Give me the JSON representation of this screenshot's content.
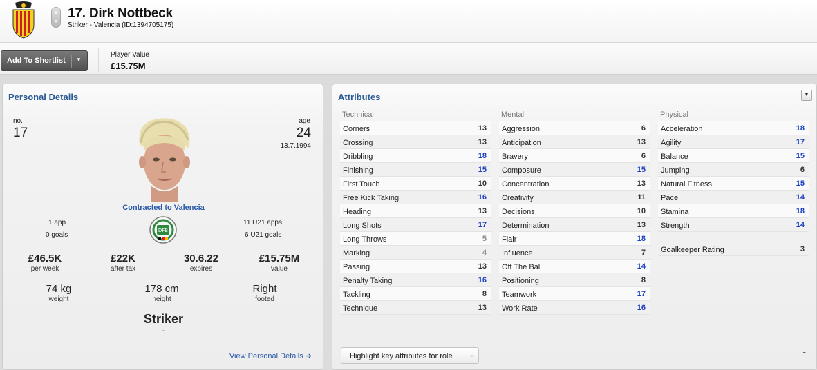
{
  "header": {
    "title": "17. Dirk Nottbeck",
    "subtitle": "Striker - Valencia (ID:1394705175)",
    "crest_icon": "valencia-crest",
    "up_icon": "chevron-up-icon",
    "down_icon": "chevron-down-icon"
  },
  "toolbar": {
    "shortlist_label": "Add To Shortlist",
    "shortlist_caret": "▼",
    "player_value_label": "Player Value",
    "player_value": "£15.75M"
  },
  "personal": {
    "title": "Personal Details",
    "no_label": "no.",
    "no_value": "17",
    "age_label": "age",
    "age_value": "24",
    "dob": "13.7.1994",
    "contract": "Contracted to Valencia",
    "apps": "1 app",
    "goals": "0 goals",
    "u21_apps": "11 U21 apps",
    "u21_goals": "6 U21 goals",
    "wage": "£46.5K",
    "wage_label": "per week",
    "after_tax": "£22K",
    "after_tax_label": "after tax",
    "expires": "30.6.22",
    "expires_label": "expires",
    "value": "£15.75M",
    "value_label": "value",
    "weight": "74 kg",
    "weight_label": "weight",
    "height": "178 cm",
    "height_label": "height",
    "foot": "Right",
    "foot_label": "footed",
    "role": "Striker",
    "role_sub": "-",
    "view_link": "View Personal Details ➔",
    "nation_icon": "germany-dfb-badge"
  },
  "attributes": {
    "title": "Attributes",
    "menu_icon": "▼",
    "colors": {
      "high": "#1a3fc4",
      "normal": "#333333",
      "low": "#8a8a8a"
    },
    "technical": {
      "heading": "Technical",
      "items": [
        {
          "name": "Corners",
          "value": "13"
        },
        {
          "name": "Crossing",
          "value": "13"
        },
        {
          "name": "Dribbling",
          "value": "18"
        },
        {
          "name": "Finishing",
          "value": "15"
        },
        {
          "name": "First Touch",
          "value": "10"
        },
        {
          "name": "Free Kick Taking",
          "value": "16"
        },
        {
          "name": "Heading",
          "value": "13"
        },
        {
          "name": "Long Shots",
          "value": "17"
        },
        {
          "name": "Long Throws",
          "value": "5"
        },
        {
          "name": "Marking",
          "value": "4"
        },
        {
          "name": "Passing",
          "value": "13"
        },
        {
          "name": "Penalty Taking",
          "value": "16"
        },
        {
          "name": "Tackling",
          "value": "8"
        },
        {
          "name": "Technique",
          "value": "13"
        }
      ]
    },
    "mental": {
      "heading": "Mental",
      "items": [
        {
          "name": "Aggression",
          "value": "6"
        },
        {
          "name": "Anticipation",
          "value": "13"
        },
        {
          "name": "Bravery",
          "value": "6"
        },
        {
          "name": "Composure",
          "value": "15"
        },
        {
          "name": "Concentration",
          "value": "13"
        },
        {
          "name": "Creativity",
          "value": "11"
        },
        {
          "name": "Decisions",
          "value": "10"
        },
        {
          "name": "Determination",
          "value": "13"
        },
        {
          "name": "Flair",
          "value": "18"
        },
        {
          "name": "Influence",
          "value": "7"
        },
        {
          "name": "Off The Ball",
          "value": "14"
        },
        {
          "name": "Positioning",
          "value": "8"
        },
        {
          "name": "Teamwork",
          "value": "17"
        },
        {
          "name": "Work Rate",
          "value": "16"
        }
      ]
    },
    "physical": {
      "heading": "Physical",
      "items": [
        {
          "name": "Acceleration",
          "value": "18"
        },
        {
          "name": "Agility",
          "value": "17"
        },
        {
          "name": "Balance",
          "value": "15"
        },
        {
          "name": "Jumping",
          "value": "6"
        },
        {
          "name": "Natural Fitness",
          "value": "15"
        },
        {
          "name": "Pace",
          "value": "14"
        },
        {
          "name": "Stamina",
          "value": "18"
        },
        {
          "name": "Strength",
          "value": "14"
        }
      ]
    },
    "gk_rating": {
      "name": "Goalkeeper Rating",
      "value": "3"
    },
    "highlight_label": "Highlight key attributes for role",
    "highlight_caret": "⌵",
    "corner_dash": "-"
  }
}
